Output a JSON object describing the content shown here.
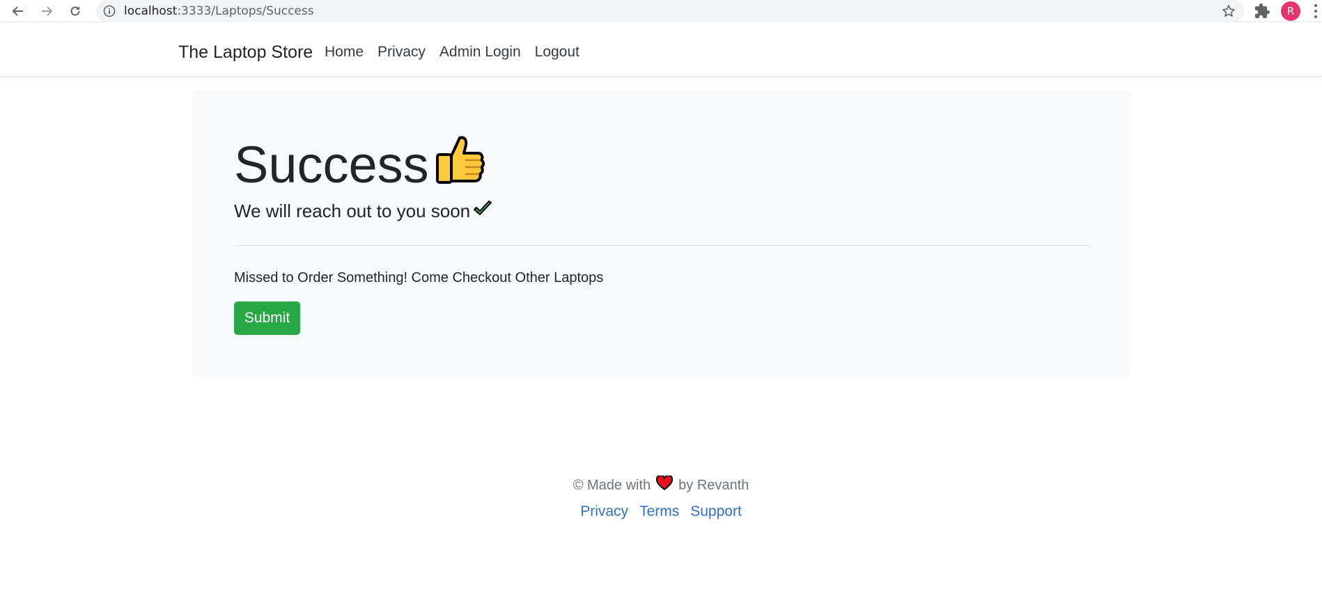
{
  "browser": {
    "url_host": "localhost",
    "url_rest": ":3333/Laptops/Success",
    "profile_initial": "R"
  },
  "navbar": {
    "brand": "The Laptop Store",
    "links": [
      "Home",
      "Privacy",
      "Admin Login",
      "Logout"
    ]
  },
  "main": {
    "title": "Success",
    "lead": "We will reach out to you soon",
    "message": "Missed to Order Something! Come Checkout Other Laptops",
    "submit_label": "Submit"
  },
  "footer": {
    "made_prefix": "© Made with",
    "made_suffix": "by Revanth",
    "links": [
      "Privacy",
      "Terms",
      "Support"
    ]
  },
  "colors": {
    "success_green": "#28a745",
    "link_blue": "#2f6fce",
    "jumbotron_bg": "#f8f9fa",
    "profile_pink": "#e8336d"
  },
  "icons": [
    "back-arrow-icon",
    "forward-arrow-icon",
    "reload-icon",
    "info-icon",
    "bookmark-star-icon",
    "extensions-puzzle-icon",
    "thumbs-up-icon",
    "checkmark-icon",
    "heart-icon"
  ]
}
